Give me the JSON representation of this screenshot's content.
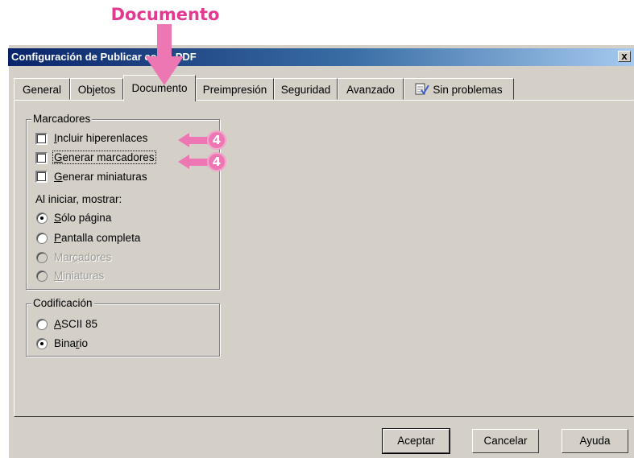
{
  "annotation": {
    "title": "Documento",
    "badge": "4"
  },
  "window": {
    "title": "Configuración de Publicar como PDF",
    "close": "x"
  },
  "tabs": [
    {
      "label": "General"
    },
    {
      "label": "Objetos"
    },
    {
      "label": "Documento",
      "active": true
    },
    {
      "label": "Preimpresión"
    },
    {
      "label": "Seguridad"
    },
    {
      "label": "Avanzado"
    },
    {
      "label": "Sin problemas"
    }
  ],
  "marcadores": {
    "legend": "Marcadores",
    "checks": [
      {
        "accel": "I",
        "rest": "ncluir hiperenlaces",
        "checked": false
      },
      {
        "accel": "G",
        "rest": "enerar marcadores",
        "checked": false
      },
      {
        "accel": "G",
        "rest": "enerar miniaturas",
        "checked": false
      }
    ],
    "start_label": "Al iniciar, mostrar:",
    "radios": [
      {
        "pre": "",
        "accel": "S",
        "rest": "ólo página",
        "checked": true,
        "enabled": true
      },
      {
        "pre": "",
        "accel": "P",
        "rest": "antalla completa",
        "checked": false,
        "enabled": true
      },
      {
        "pre": "Mar",
        "accel": "c",
        "rest": "adores",
        "checked": false,
        "enabled": false
      },
      {
        "pre": "",
        "accel": "M",
        "rest": "iniaturas",
        "checked": false,
        "enabled": false
      }
    ]
  },
  "codificacion": {
    "legend": "Codificación",
    "radios": [
      {
        "pre": "",
        "accel": "A",
        "rest": "SCII 85",
        "checked": false
      },
      {
        "pre": "Bina",
        "accel": "r",
        "rest": "io",
        "checked": true
      }
    ]
  },
  "buttons": {
    "ok": "Aceptar",
    "cancel": "Cancelar",
    "help": "Ayuda"
  },
  "colors": {
    "annotation": "#ec77b3",
    "annotation_text": "#e23a8f",
    "dialog_bg": "#d4d0c8",
    "titlebar": "#0a246a"
  }
}
